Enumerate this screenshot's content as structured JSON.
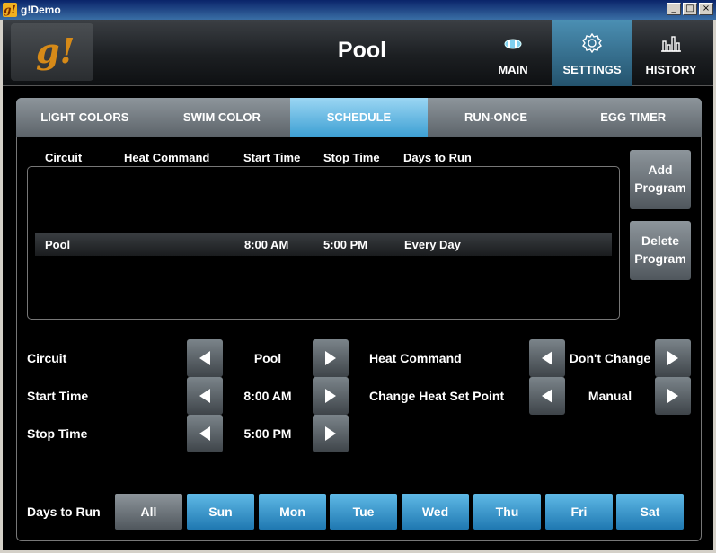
{
  "window": {
    "title": "g!Demo",
    "app_icon": "g!",
    "minimize": "_",
    "maximize": "□",
    "close": "×"
  },
  "header": {
    "logo": "g!",
    "title": "Pool",
    "nav": [
      {
        "label": "MAIN",
        "icon": "pool-icon"
      },
      {
        "label": "SETTINGS",
        "icon": "gear-icon"
      },
      {
        "label": "HISTORY",
        "icon": "bar-chart-icon"
      }
    ],
    "active_nav": "SETTINGS"
  },
  "tabs": [
    "LIGHT COLORS",
    "SWIM COLOR",
    "SCHEDULE",
    "RUN-ONCE",
    "EGG TIMER"
  ],
  "active_tab": "SCHEDULE",
  "schedule_list": {
    "columns": [
      "Circuit",
      "Heat Command",
      "Start Time",
      "Stop Time",
      "Days to Run"
    ],
    "rows": [
      {
        "circuit": "Pool",
        "heat_command": "",
        "start_time": "8:00  AM",
        "stop_time": "5:00  PM",
        "days": "Every Day"
      }
    ]
  },
  "actions": {
    "add_line1": "Add",
    "add_line2": "Program",
    "delete_line1": "Delete",
    "delete_line2": "Program"
  },
  "form": {
    "circuit_label": "Circuit",
    "circuit_value": "Pool",
    "start_label": "Start Time",
    "start_value": "8:00  AM",
    "stop_label": "Stop Time",
    "stop_value": "5:00  PM",
    "heat_label": "Heat Command",
    "heat_value": "Don't Change",
    "setpoint_label": "Change Heat Set Point",
    "setpoint_value": "Manual"
  },
  "days": {
    "label": "Days to Run",
    "buttons": [
      "All",
      "Sun",
      "Mon",
      "Tue",
      "Wed",
      "Thu",
      "Fri",
      "Sat"
    ]
  },
  "colors": {
    "accent": "#3c9fd3",
    "logo": "#d68a18",
    "background": "#000000"
  }
}
